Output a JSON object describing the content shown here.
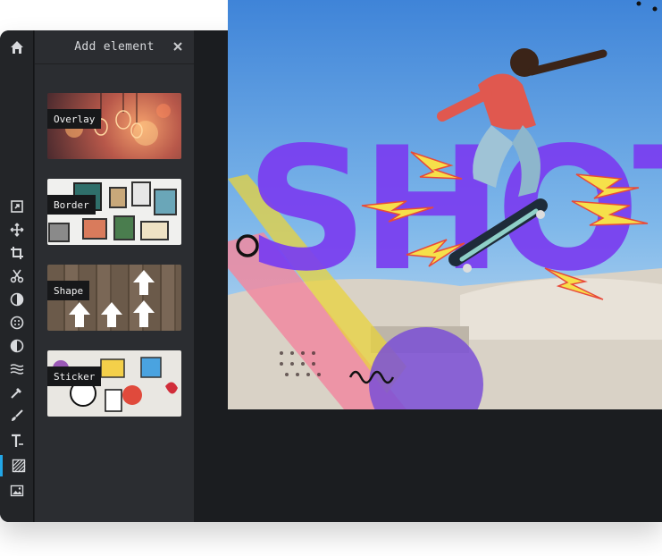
{
  "panel": {
    "title": "Add element",
    "close_icon": "close-icon"
  },
  "elements": [
    {
      "label": "Overlay"
    },
    {
      "label": "Border"
    },
    {
      "label": "Shape"
    },
    {
      "label": "Sticker"
    }
  ],
  "toolbar": {
    "tools": [
      "home-icon",
      "resize-icon",
      "move-icon",
      "crop-icon",
      "cut-icon",
      "exposure-icon",
      "dots-icon",
      "contrast-icon",
      "wave-icon",
      "dropper-icon",
      "brush-icon",
      "text-icon",
      "add-element-icon",
      "image-icon"
    ],
    "active_tool": "add-element-icon"
  },
  "canvas": {
    "headline": "SHOT"
  },
  "colors": {
    "accent": "#22a6e6",
    "headline": "#7a3ef0",
    "bolt": "#f6e04a"
  }
}
